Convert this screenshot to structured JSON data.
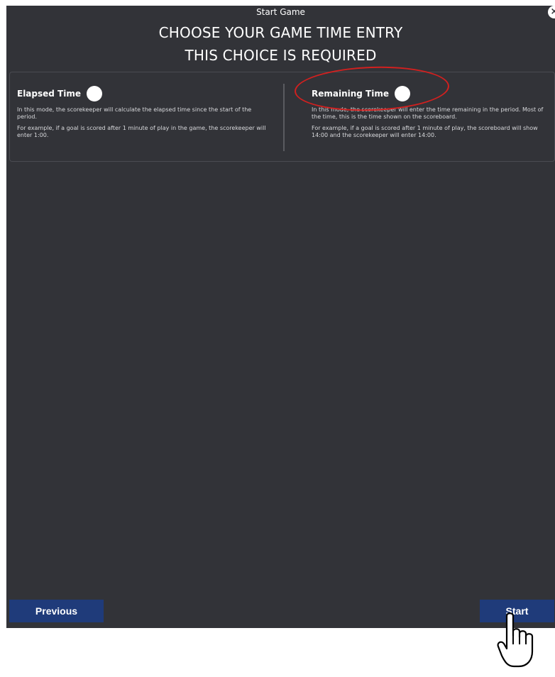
{
  "dialog": {
    "title": "Start Game",
    "close_icon": "×",
    "heading_line1": "CHOOSE YOUR GAME TIME ENTRY",
    "heading_line2": "THIS CHOICE IS REQUIRED"
  },
  "options": [
    {
      "label": "Elapsed Time",
      "selected": false,
      "description": "In this mode, the scorekeeper will calculate the elapsed time since the start of the period.",
      "example": "For example, if a goal is scored after 1 minute of play in the game, the scorekeeper will enter 1:00."
    },
    {
      "label": "Remaining Time",
      "selected": false,
      "description": "In this mode, the scorekeeper will enter the time remaining in the period. Most of the time, this is the time shown on the scoreboard.",
      "example": "For example, if a goal is scored after 1 minute of play, the scoreboard will show 14:00 and the scorekeeper will enter 14:00."
    }
  ],
  "footer": {
    "previous_label": "Previous",
    "start_label": "Start"
  },
  "colors": {
    "background": "#323338",
    "button": "#1f3b7a",
    "highlight": "#d2201f"
  },
  "icons": [
    "close-icon",
    "pointer-hand-icon"
  ]
}
